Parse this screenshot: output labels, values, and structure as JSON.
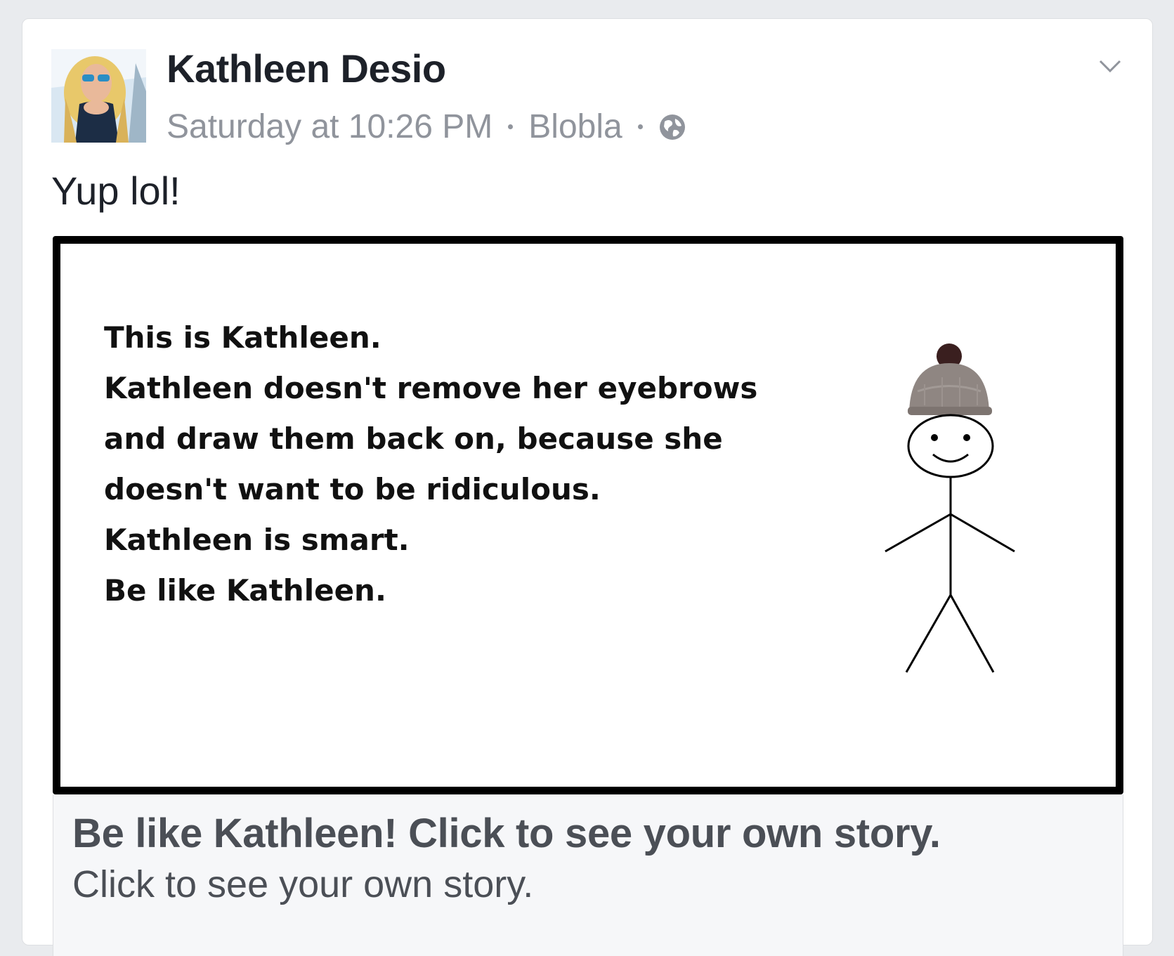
{
  "post": {
    "author": "Kathleen Desio",
    "timestamp": "Saturday at 10:26 PM",
    "location": "Blobla",
    "privacy_icon": "globe-icon",
    "menu_icon": "chevron-down-icon",
    "text": "Yup lol!"
  },
  "meme": {
    "lines": [
      "This is Kathleen.",
      "Kathleen doesn't remove her eyebrows",
      "and draw them back on, because she",
      "doesn't want to be ridiculous.",
      "Kathleen is smart.",
      "Be like Kathleen."
    ]
  },
  "link": {
    "title": "Be like Kathleen! Click to see your own story.",
    "description": "Click to see your own story."
  },
  "colors": {
    "background": "#e9ebee",
    "card": "#ffffff",
    "author_text": "#1d2129",
    "meta_text": "#90949c",
    "link_box": "#f6f7f9",
    "link_text": "#4b4f56"
  }
}
